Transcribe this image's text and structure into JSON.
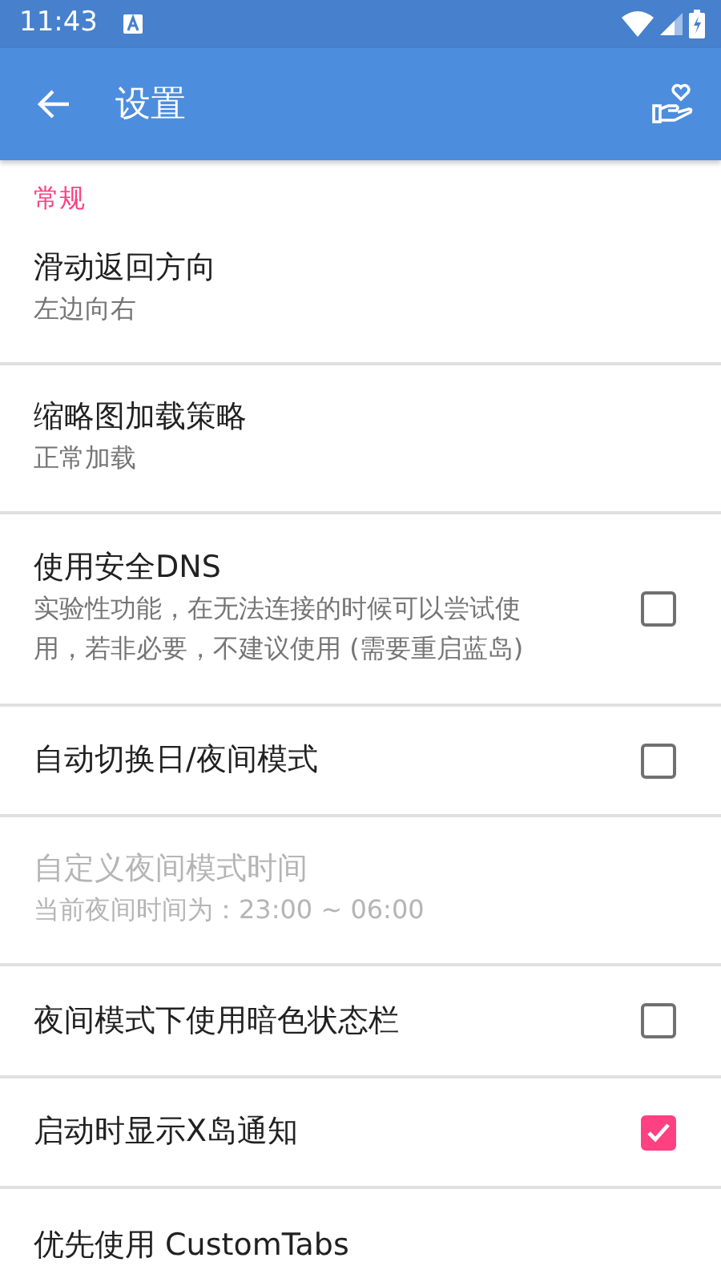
{
  "status_bar": {
    "time": "11:43"
  },
  "app_bar": {
    "title": "设置"
  },
  "section": {
    "title": "常规"
  },
  "settings": [
    {
      "kind": "choice",
      "title": "滑动返回方向",
      "summary": "左边向右",
      "disabled": false
    },
    {
      "kind": "choice",
      "title": "缩略图加载策略",
      "summary": "正常加载",
      "disabled": false
    },
    {
      "kind": "checkbox",
      "title": "使用安全DNS",
      "summary": "实验性功能，在无法连接的时候可以尝试使用，若非必要，不建议使用 (需要重启蓝岛)",
      "checked": false,
      "disabled": false
    },
    {
      "kind": "checkbox",
      "title": "自动切换日/夜间模式",
      "checked": false,
      "disabled": false
    },
    {
      "kind": "choice",
      "title": "自定义夜间模式时间",
      "summary": "当前夜间时间为：23:00 ~ 06:00",
      "disabled": true
    },
    {
      "kind": "checkbox",
      "title": "夜间模式下使用暗色状态栏",
      "checked": false,
      "disabled": false
    },
    {
      "kind": "checkbox",
      "title": "启动时显示X岛通知",
      "checked": true,
      "disabled": false
    },
    {
      "kind": "choice",
      "title": "优先使用 CustomTabs",
      "disabled": false
    }
  ]
}
